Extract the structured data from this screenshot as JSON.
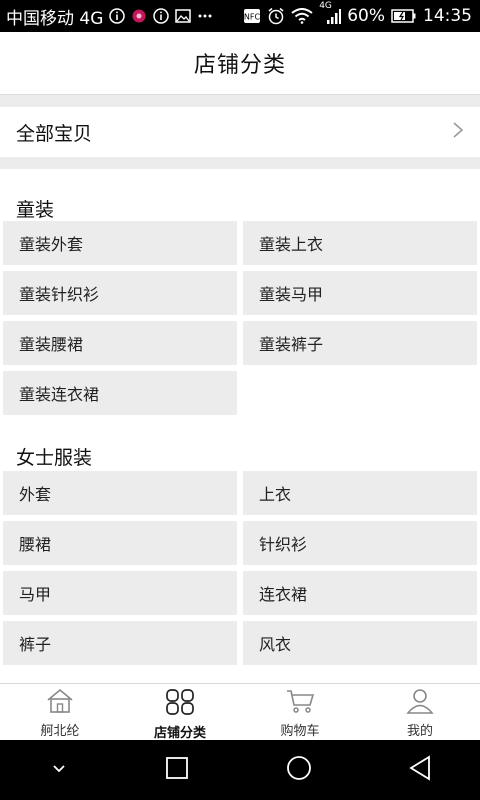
{
  "status_bar": {
    "carrier": "中国移动 4G",
    "battery": "60%",
    "time": "14:35",
    "network_small": "4G"
  },
  "header": {
    "title": "店铺分类"
  },
  "all_items": {
    "label": "全部宝贝"
  },
  "sections": [
    {
      "title": "童装",
      "items": [
        "童装外套",
        "童装上衣",
        "童装针织衫",
        "童装马甲",
        "童装腰裙",
        "童装裤子",
        "童装连衣裙"
      ]
    },
    {
      "title": "女士服装",
      "items": [
        "外套",
        "上衣",
        "腰裙",
        "针织衫",
        "马甲",
        "连衣裙",
        "裤子",
        "风衣"
      ]
    }
  ],
  "tab_bar": {
    "tabs": [
      {
        "label": "舸北纶",
        "icon": "home-icon"
      },
      {
        "label": "店铺分类",
        "icon": "category-icon",
        "active": true
      },
      {
        "label": "购物车",
        "icon": "cart-icon"
      },
      {
        "label": "我的",
        "icon": "user-icon"
      }
    ]
  }
}
